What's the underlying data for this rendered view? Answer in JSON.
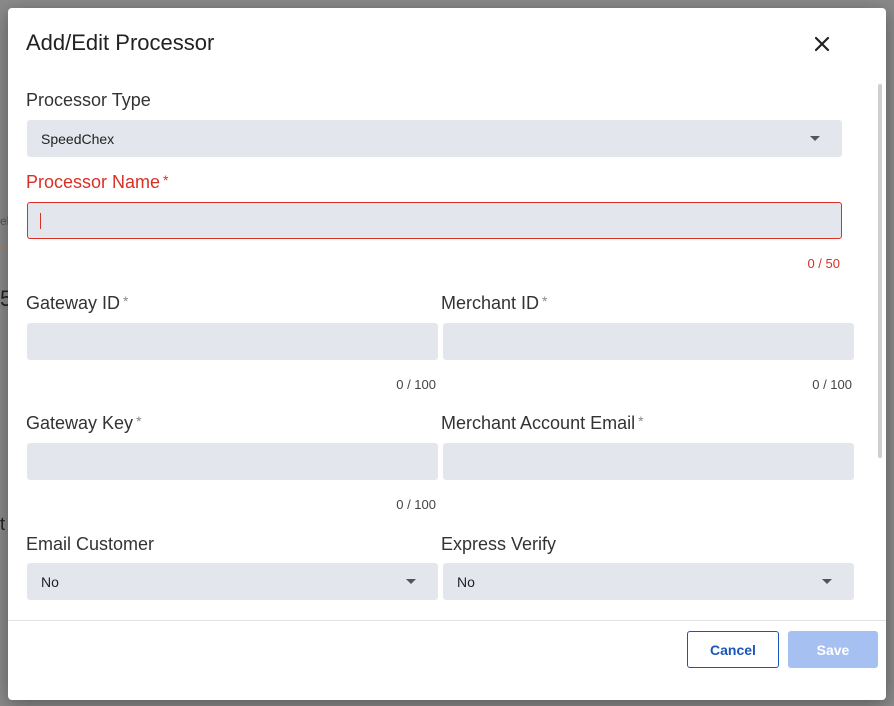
{
  "dialog": {
    "title": "Add/Edit Processor",
    "close_label": "×"
  },
  "form": {
    "processor_type": {
      "label": "Processor Type",
      "value": "SpeedChex"
    },
    "processor_name": {
      "label": "Processor Name",
      "required": "*",
      "value": "",
      "counter": "0 / 50"
    },
    "gateway_id": {
      "label": "Gateway ID",
      "required": "*",
      "value": "",
      "counter": "0 / 100"
    },
    "merchant_id": {
      "label": "Merchant ID",
      "required": "*",
      "value": "",
      "counter": "0 / 100"
    },
    "gateway_key": {
      "label": "Gateway Key",
      "required": "*",
      "value": "",
      "counter": "0 / 100"
    },
    "merchant_account_email": {
      "label": "Merchant Account Email",
      "required": "*",
      "value": ""
    },
    "email_customer": {
      "label": "Email Customer",
      "value": "No"
    },
    "express_verify": {
      "label": "Express Verify",
      "value": "No"
    }
  },
  "footer": {
    "cancel_label": "Cancel",
    "save_label": "Save"
  },
  "background": {
    "fragment_1": "el",
    "fragment_2": "T",
    "fragment_3": "5",
    "fragment_4": "t"
  },
  "colors": {
    "error": "#d93025",
    "primary": "#1a56b8",
    "save_disabled": "#a7c0f2",
    "field_bg": "#e3e6ec"
  }
}
